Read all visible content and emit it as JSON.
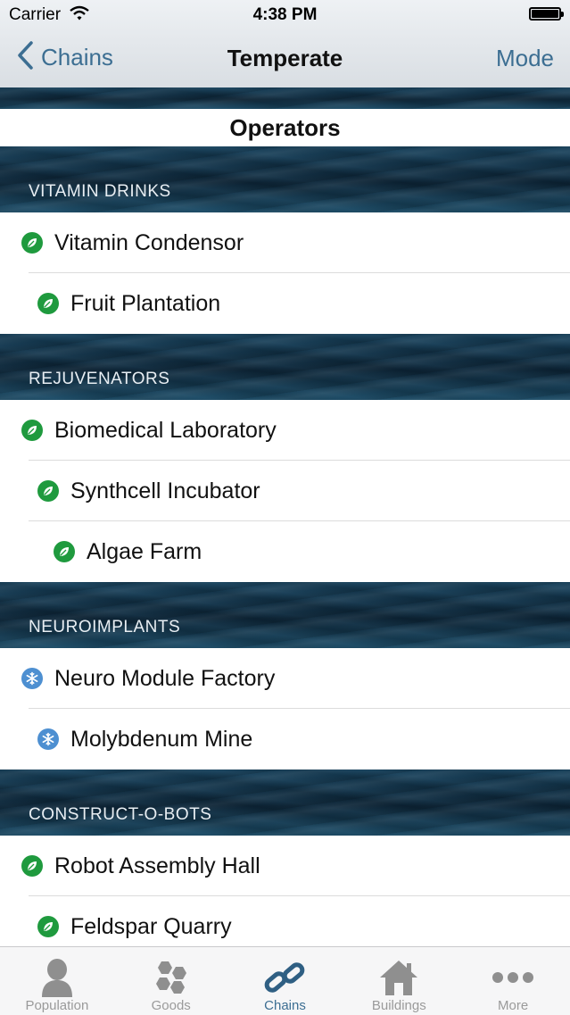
{
  "status_bar": {
    "carrier": "Carrier",
    "time": "4:38 PM"
  },
  "nav": {
    "back_label": "Chains",
    "title": "Temperate",
    "right_label": "Mode"
  },
  "operators_title": "Operators",
  "sections": [
    {
      "header": "VITAMIN DRINKS",
      "rows": [
        {
          "label": "Vitamin Condensor",
          "icon": "leaf-icon",
          "indent": 0
        },
        {
          "label": "Fruit Plantation",
          "icon": "leaf-icon",
          "indent": 1
        }
      ]
    },
    {
      "header": "REJUVENATORS",
      "rows": [
        {
          "label": "Biomedical Laboratory",
          "icon": "leaf-icon",
          "indent": 0
        },
        {
          "label": "Synthcell Incubator",
          "icon": "leaf-icon",
          "indent": 1
        },
        {
          "label": "Algae Farm",
          "icon": "leaf-icon",
          "indent": 2
        }
      ]
    },
    {
      "header": "NEUROIMPLANTS",
      "rows": [
        {
          "label": "Neuro Module Factory",
          "icon": "snowflake-icon",
          "indent": 0
        },
        {
          "label": "Molybdenum Mine",
          "icon": "snowflake-icon",
          "indent": 1
        }
      ]
    },
    {
      "header": "CONSTRUCT-O-BOTS",
      "rows": [
        {
          "label": "Robot Assembly Hall",
          "icon": "leaf-icon",
          "indent": 0
        },
        {
          "label": "Feldspar Quarry",
          "icon": "leaf-icon",
          "indent": 1
        }
      ]
    }
  ],
  "tabs": [
    {
      "label": "Population",
      "icon": "person-icon",
      "active": false
    },
    {
      "label": "Goods",
      "icon": "hexagons-icon",
      "active": false
    },
    {
      "label": "Chains",
      "icon": "chain-link-icon",
      "active": true
    },
    {
      "label": "Buildings",
      "icon": "house-icon",
      "active": false
    },
    {
      "label": "More",
      "icon": "more-dots-icon",
      "active": false
    }
  ],
  "colors": {
    "accent": "#3c6e92",
    "leaf_badge": "#1f9a3e",
    "snow_badge": "#4d8fd1",
    "tab_inactive": "#9a9a9a"
  }
}
